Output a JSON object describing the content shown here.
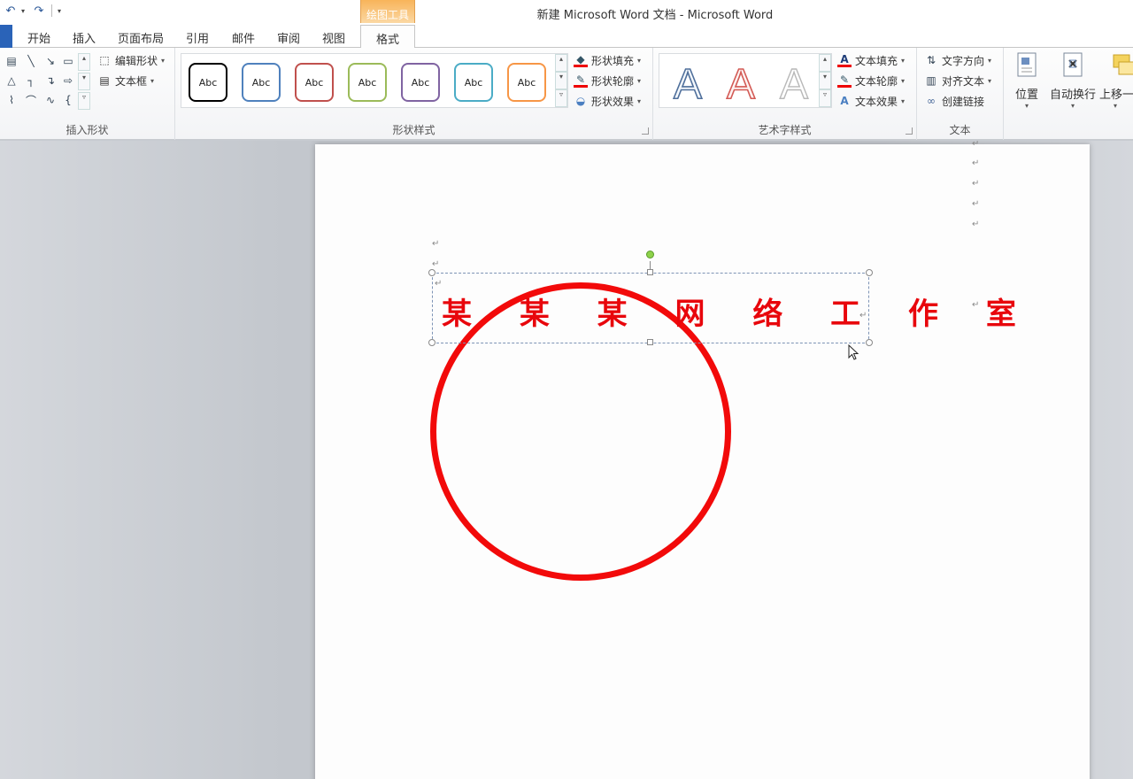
{
  "quick_access": {
    "icons": [
      "undo-icon",
      "redo-icon",
      "customize-qat-icon"
    ]
  },
  "window": {
    "title": "新建 Microsoft Word 文档 - Microsoft Word",
    "context_tool": "绘图工具"
  },
  "tabs": {
    "items": [
      "开始",
      "插入",
      "页面布局",
      "引用",
      "邮件",
      "审阅",
      "视图"
    ],
    "active": "格式"
  },
  "ribbon": {
    "insert_shapes": {
      "label": "插入形状",
      "edit_shape": "编辑形状",
      "text_box": "文本框"
    },
    "shape_styles": {
      "label": "形状样式",
      "styles": [
        {
          "text": "Abc",
          "color": "#000000"
        },
        {
          "text": "Abc",
          "color": "#4f81bd"
        },
        {
          "text": "Abc",
          "color": "#c0504d"
        },
        {
          "text": "Abc",
          "color": "#9bbb59"
        },
        {
          "text": "Abc",
          "color": "#8064a2"
        },
        {
          "text": "Abc",
          "color": "#4bacc6"
        },
        {
          "text": "Abc",
          "color": "#f79646"
        }
      ],
      "fill": "形状填充",
      "outline": "形状轮廓",
      "effects": "形状效果"
    },
    "wordart_styles": {
      "label": "艺术字样式",
      "glyph": "A",
      "text_fill": "文本填充",
      "text_outline": "文本轮廓",
      "text_effects": "文本效果"
    },
    "text": {
      "label": "文本",
      "direction": "文字方向",
      "align": "对齐文本",
      "link": "创建链接"
    },
    "arrange": {
      "position": "位置",
      "wrap": "自动换行",
      "bring_forward": "上移一"
    }
  },
  "document": {
    "seal_text": "某 某 某 网 络 工 作 室",
    "paragraph_mark": "↵",
    "seal_color": "#f20a0a"
  }
}
